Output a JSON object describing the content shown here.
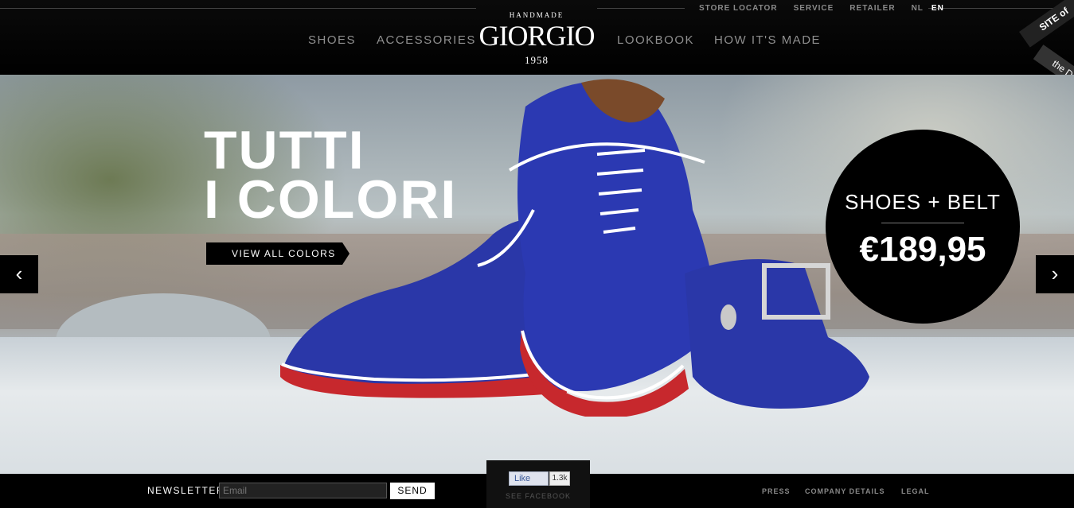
{
  "header": {
    "utility": [
      "STORE LOCATOR",
      "SERVICE",
      "RETAILER",
      "NL",
      "EN"
    ],
    "nav_left": [
      "SHOES",
      "ACCESSORIES"
    ],
    "nav_right": [
      "LOOKBOOK",
      "HOW IT'S MADE"
    ],
    "logo": {
      "top": "HANDMADE",
      "word": "GIORGIO",
      "year": "1958"
    },
    "badge": {
      "line1": "SITE of",
      "line2": "the DAY"
    }
  },
  "hero": {
    "headline": "TUTTI\nI COLORI",
    "cta_label": "VIEW ALL COLORS",
    "prev_icon": "‹",
    "next_icon": "›",
    "price_title": "SHOES + BELT",
    "price_value": "€189,95",
    "colors": {
      "shoe": "#2a37a8",
      "sole_red": "#c7282d"
    }
  },
  "footer": {
    "newsletter_label": "NEWSLETTER",
    "email_placeholder": "Email",
    "send_label": "SEND",
    "fb_like": "Like",
    "fb_count": "1.3k",
    "fb_see": "SEE FACEBOOK",
    "links": [
      "PRESS",
      "COMPANY DETAILS",
      "LEGAL"
    ]
  }
}
